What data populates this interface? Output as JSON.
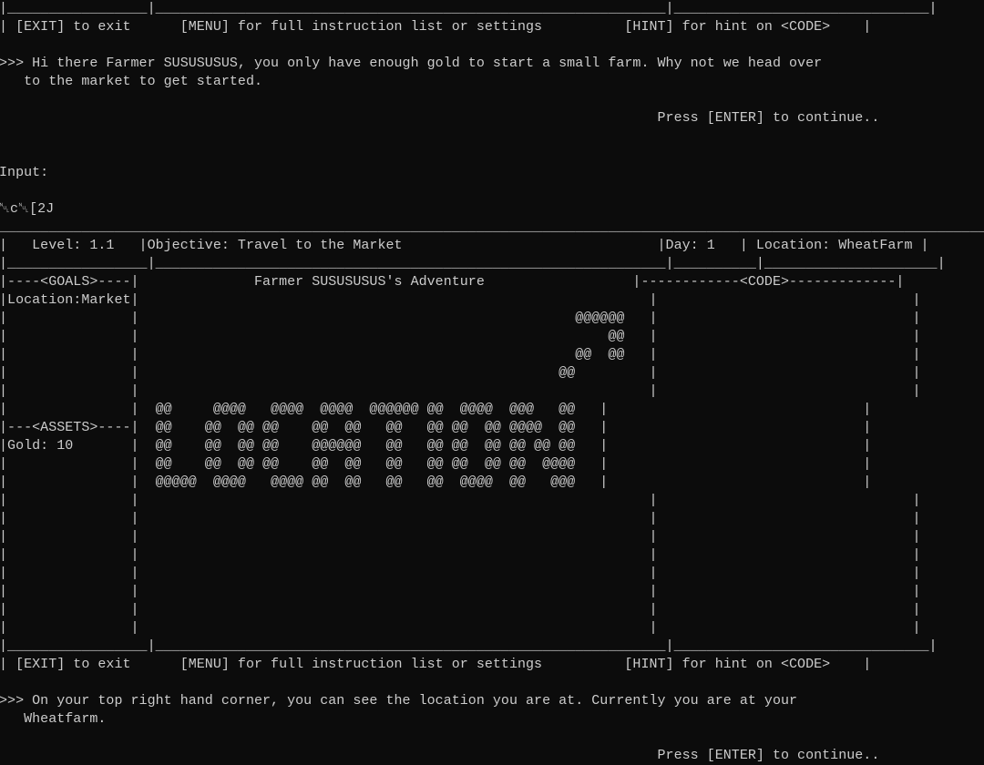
{
  "terminal": {
    "lines": [
      "|_________________|______________________________________________________________|_______________________________|",
      "| [EXIT] to exit      [MENU] for full instruction list or settings          [HINT] for hint on <CODE>    |",
      "",
      ">>> Hi there Farmer SUSUSUSUS, you only have enough gold to start a small farm. Why not we head over",
      "   to the market to get started.",
      "",
      "                                                                                Press [ENTER] to continue..",
      "",
      "",
      "Input:",
      "",
      "␀c␀[2J",
      "_________________________________________________________________________________________________________________________.",
      "|   Level: 1.1   |Objective: Travel to the Market                               |Day: 1   | Location: WheatFarm |",
      "|_________________|______________________________________________________________|__________|_____________________|",
      "|----<GOALS>----|              Farmer SUSUSUSUS's Adventure                  |------------<CODE>-------------|",
      "|Location:Market|                                                              |                               |",
      "|               |                                                     @@@@@@   |                               |",
      "|               |                                                         @@   |                               |",
      "|               |                                                     @@  @@   |                               |",
      "|               |                                                   @@         |                               |",
      "|               |                                                              |                               |",
      "|               |  @@     @@@@   @@@@  @@@@  @@@@@@ @@  @@@@  @@@   @@   |                               |",
      "|---<ASSETS>----|  @@    @@  @@ @@    @@  @@   @@   @@ @@  @@ @@@@  @@   |                               |",
      "|Gold: 10       |  @@    @@  @@ @@    @@@@@@   @@   @@ @@  @@ @@ @@ @@   |                               |",
      "|               |  @@    @@  @@ @@    @@  @@   @@   @@ @@  @@ @@  @@@@   |                               |",
      "|               |  @@@@@  @@@@   @@@@ @@  @@   @@   @@  @@@@  @@   @@@   |                               |",
      "|               |                                                              |                               |",
      "|               |                                                              |                               |",
      "|               |                                                              |                               |",
      "|               |                                                              |                               |",
      "|               |                                                              |                               |",
      "|               |                                                              |                               |",
      "|               |                                                              |                               |",
      "|               |                                                              |                               |",
      "|_________________|______________________________________________________________|_______________________________|",
      "| [EXIT] to exit      [MENU] for full instruction list or settings          [HINT] for hint on <CODE>    |",
      "",
      ">>> On your top right hand corner, you can see the location you are at. Currently you are at your",
      "   Wheatfarm.",
      "",
      "                                                                                Press [ENTER] to continue.."
    ]
  }
}
